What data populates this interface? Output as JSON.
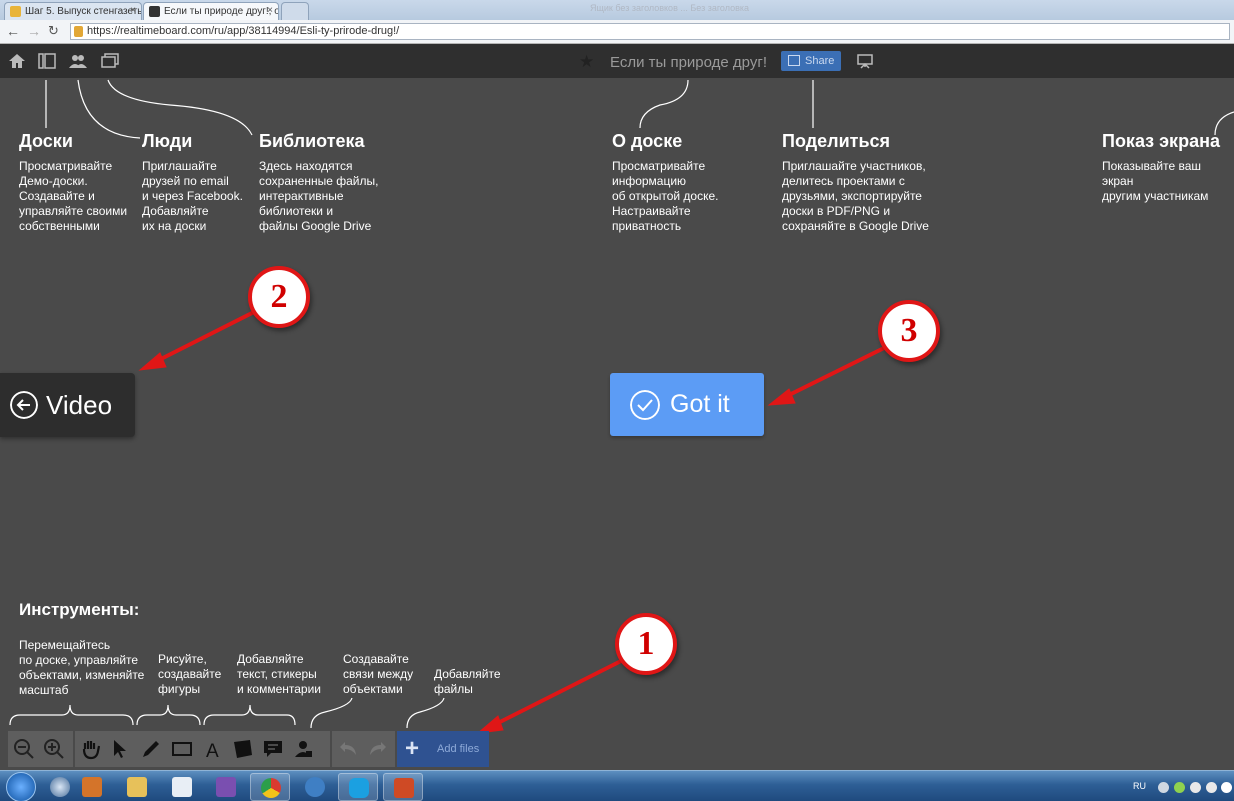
{
  "browser": {
    "tabs": [
      {
        "title": "Шаг 5. Выпуск стенгазеты",
        "close": "×"
      },
      {
        "title": "Если ты природе друг!, о",
        "close": "×"
      },
      {
        "title": "",
        "close": ""
      }
    ],
    "blurred_tabs_text": "Ящик без заголовков ... Без заголовка",
    "url": "https://realtimeboard.com/ru/app/38114994/Esli-ty-prirode-drug!/"
  },
  "appbar": {
    "board_title": "Если ты природе друг!",
    "share_label": "Share"
  },
  "tips": {
    "boards": {
      "title": "Доски",
      "desc": "Просматривайте\nДемо-доски.\nСоздавайте и\nуправляйте своими\nсобственными"
    },
    "people": {
      "title": "Люди",
      "desc": "Приглашайте\nдрузей по email\nи через Facebook.\nДобавляйте\nих на доски"
    },
    "library": {
      "title": "Библиотека",
      "desc": "Здесь находятся\nсохраненные файлы,\nинтерактивные\nбиблиотеки и\nфайлы Google Drive"
    },
    "about": {
      "title": "О доске",
      "desc": "Просматривайте\nинформацию\nоб открытой доске.\nНастраивайте\nприватность"
    },
    "share": {
      "title": "Поделиться",
      "desc": "Приглашайте участников,\nделитесь проектами с\nдрузьями, экспортируйте\nдоски в PDF/PNG и\nсохраняйте в Google Drive"
    },
    "screen": {
      "title": "Показ экрана",
      "desc": "Показывайте ваш экран\nдругим участникам"
    }
  },
  "buttons": {
    "video": "Video",
    "got_it": "Got it"
  },
  "badges": [
    "1",
    "2",
    "3"
  ],
  "tools": {
    "title": "Инструменты:",
    "navigate": "Перемещайтесь\nпо доске, управляйте\nобъектами, изменяйте\nмасштаб",
    "draw": "Рисуйте,\nсоздавайте\nфигуры",
    "add": "Добавляйте\nтекст, стикеры\nи комментарии",
    "connect": "Создавайте\nсвязи между\nобъектами",
    "files": "Добавляйте\nфайлы",
    "add_files_label": "Add files"
  },
  "taskbar": {
    "lang": "RU"
  },
  "colors": {
    "accent_blue": "#5c9cf5",
    "annotation_red": "#e01616",
    "background": "#4a4a4a"
  }
}
